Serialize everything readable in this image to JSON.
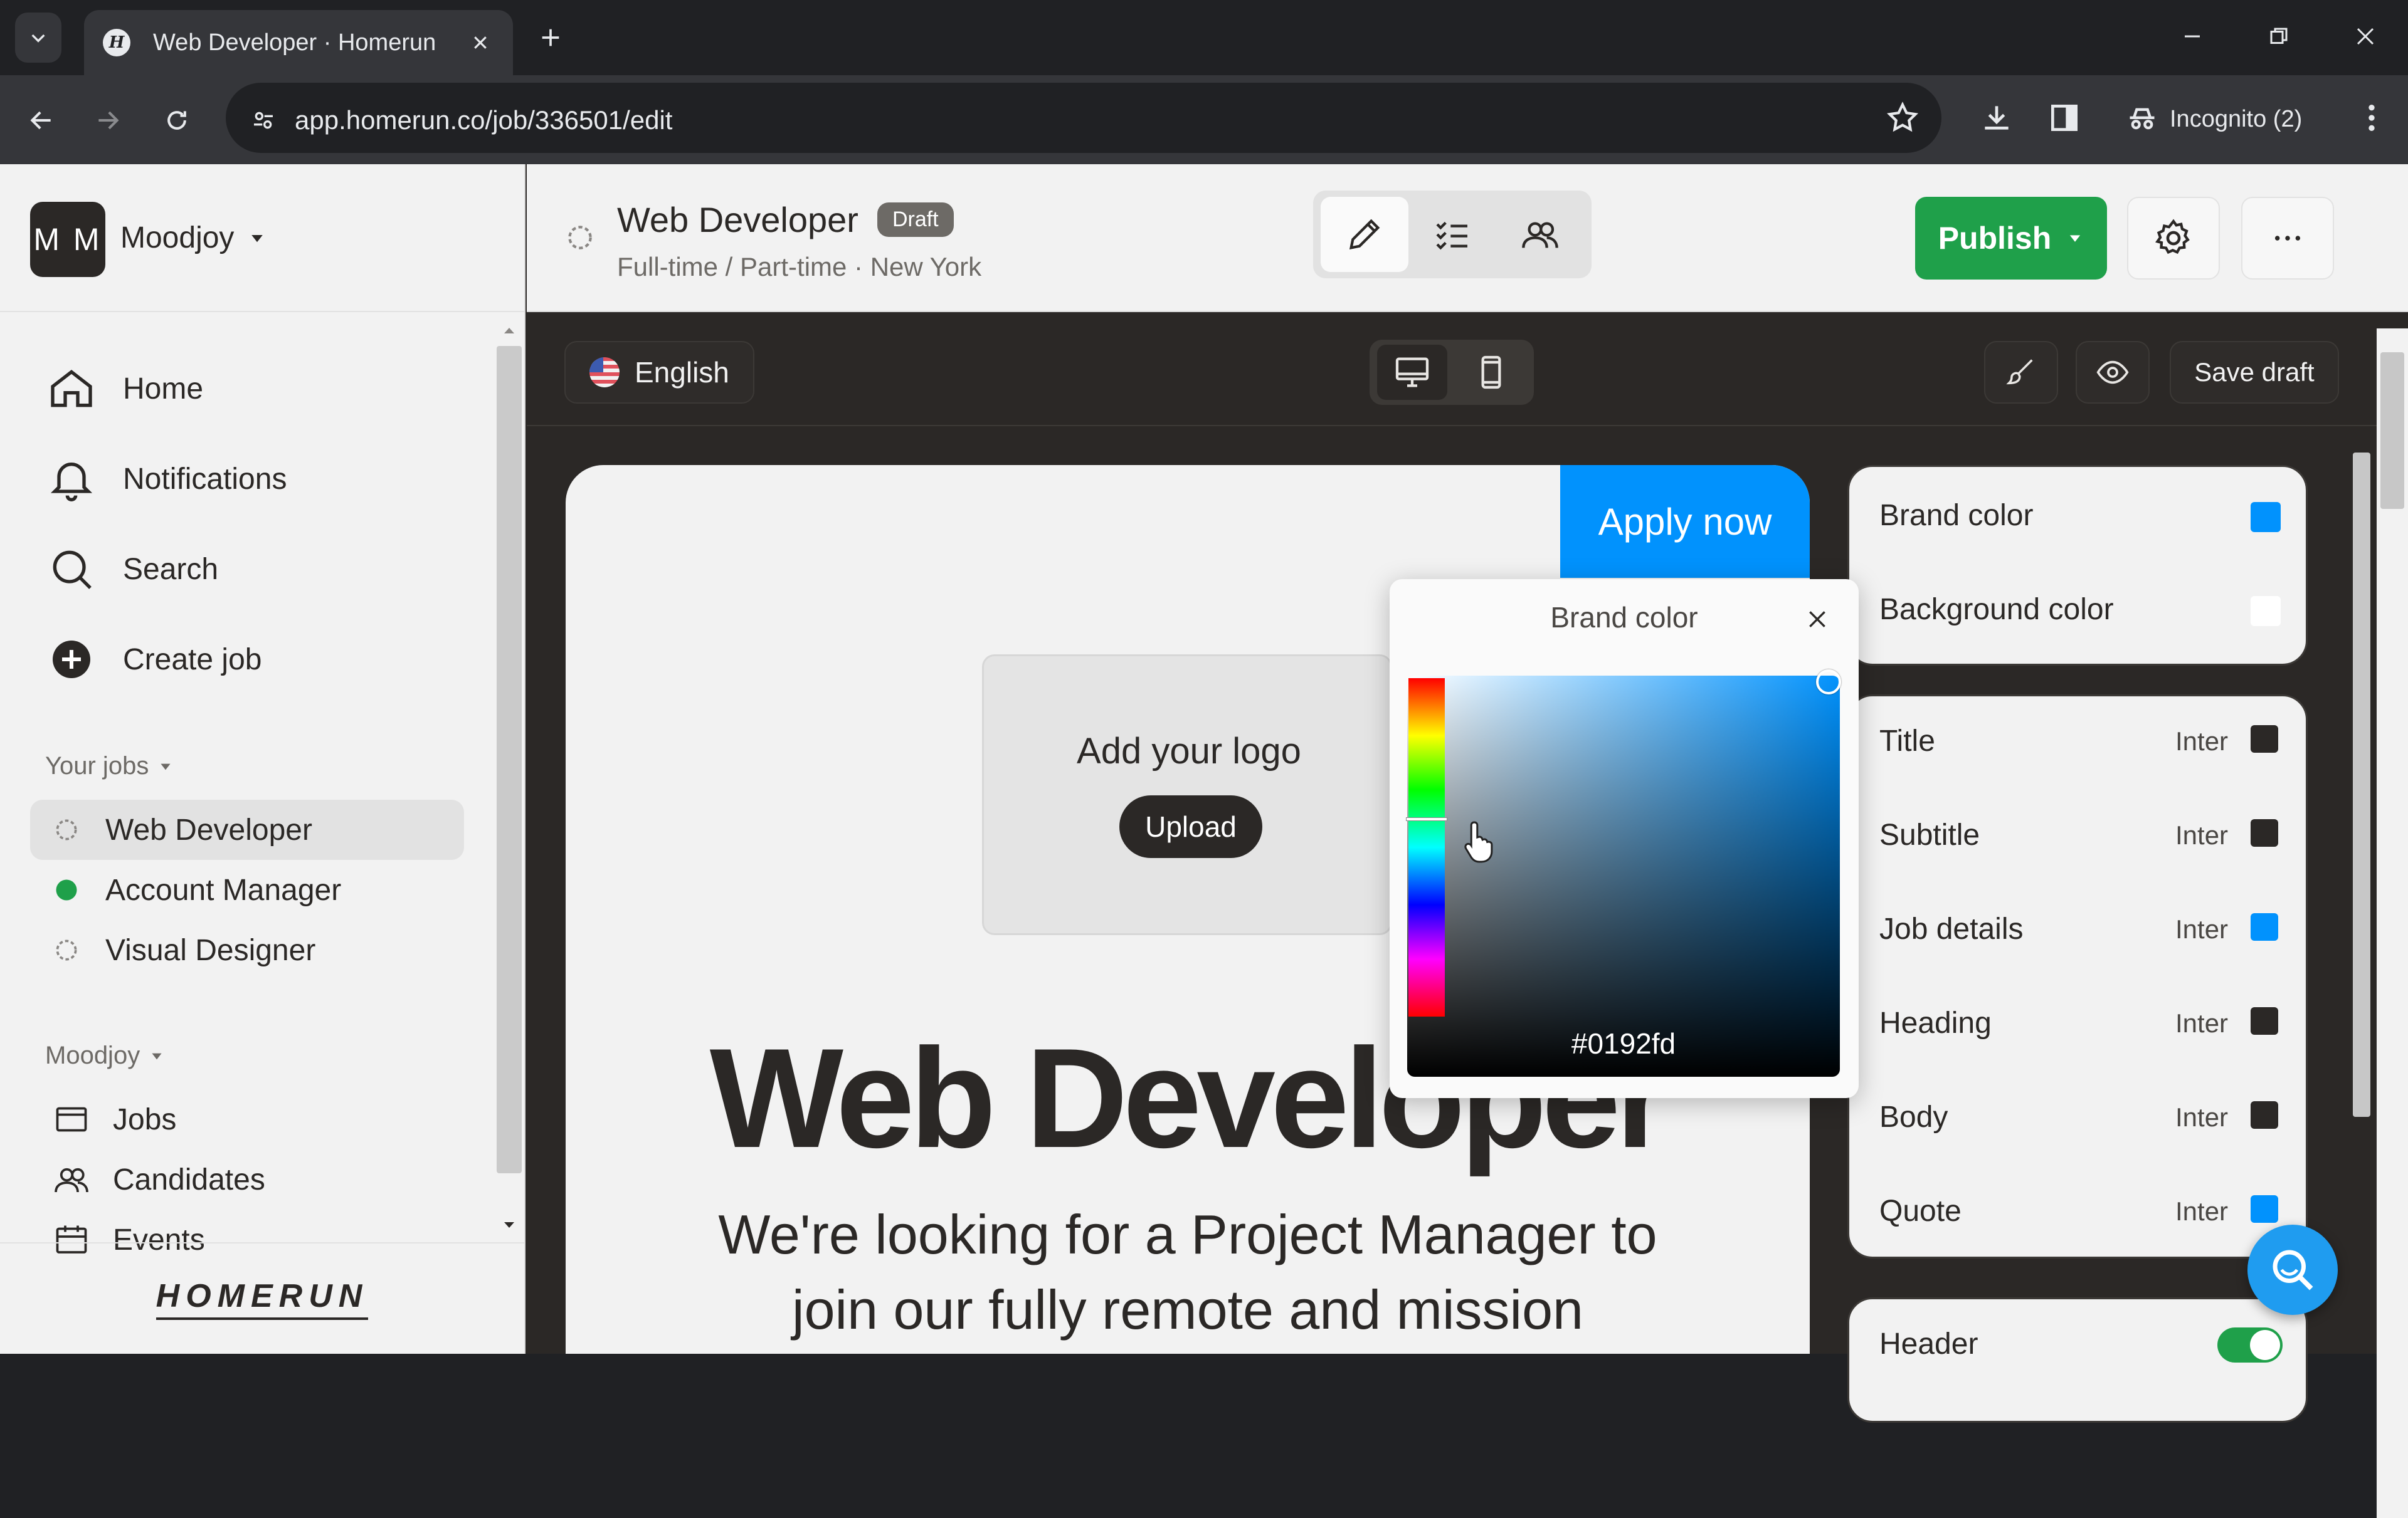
{
  "browser": {
    "tab_title": "Web Developer · Homerun",
    "url": "app.homerun.co/job/336501/edit",
    "incognito_label": "Incognito (2)"
  },
  "sidebar": {
    "avatar_initials": "M M",
    "company": "Moodjoy",
    "nav": [
      {
        "label": "Home",
        "icon": "home-icon"
      },
      {
        "label": "Notifications",
        "icon": "bell-icon"
      },
      {
        "label": "Search",
        "icon": "search-icon"
      },
      {
        "label": "Create job",
        "icon": "plus-circle-icon"
      }
    ],
    "your_jobs_label": "Your jobs",
    "jobs": [
      {
        "label": "Web Developer",
        "status": "draft"
      },
      {
        "label": "Account Manager",
        "status": "published"
      },
      {
        "label": "Visual Designer",
        "status": "draft"
      }
    ],
    "company_section_label": "Moodjoy",
    "company_links": [
      {
        "label": "Jobs",
        "icon": "jobs-icon"
      },
      {
        "label": "Candidates",
        "icon": "candidates-icon"
      },
      {
        "label": "Events",
        "icon": "calendar-icon"
      }
    ],
    "footer_logo": "HOMERUN"
  },
  "header": {
    "job_title": "Web Developer",
    "badge": "Draft",
    "subtitle": "Full-time / Part-time · New York",
    "publish_label": "Publish"
  },
  "editor_toolbar": {
    "language": "English",
    "save_draft_label": "Save draft"
  },
  "canvas": {
    "apply_label": "Apply now",
    "logo_prompt": "Add your logo",
    "upload_label": "Upload",
    "title": "Web Developer",
    "intro_line1": "We're looking for a Project Manager to",
    "intro_line2": "join our fully remote and mission"
  },
  "color_picker": {
    "title": "Brand color",
    "hex": "#0192fd"
  },
  "style_panel": {
    "colors": [
      {
        "label": "Brand color",
        "swatch": "#0192fd"
      },
      {
        "label": "Background color",
        "swatch": "#ffffff"
      }
    ],
    "typography": [
      {
        "label": "Title",
        "font": "Inter",
        "swatch": "#2b2826"
      },
      {
        "label": "Subtitle",
        "font": "Inter",
        "swatch": "#2b2826"
      },
      {
        "label": "Job details",
        "font": "Inter",
        "swatch": "#0192fd"
      },
      {
        "label": "Heading",
        "font": "Inter",
        "swatch": "#2b2826"
      },
      {
        "label": "Body",
        "font": "Inter",
        "swatch": "#2b2826"
      },
      {
        "label": "Quote",
        "font": "Inter",
        "swatch": "#0192fd"
      }
    ],
    "header_label": "Header",
    "header_toggle_on": true
  },
  "colors": {
    "brand": "#0192fd",
    "publish": "#1fa04a",
    "dark": "#2b2826"
  }
}
